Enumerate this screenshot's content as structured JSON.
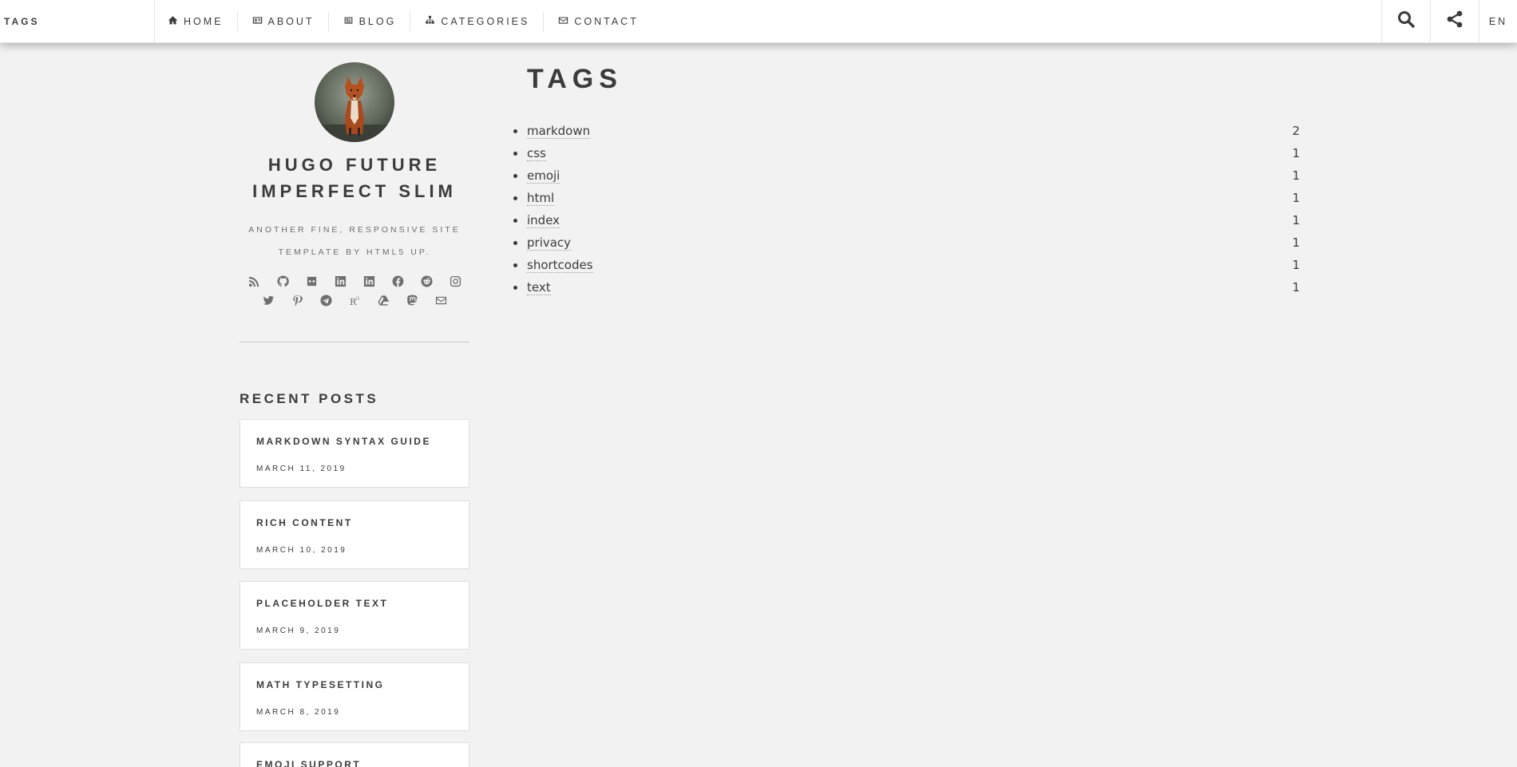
{
  "header": {
    "brand": "TAGS",
    "nav": [
      {
        "label": "HOME",
        "icon": "home-icon"
      },
      {
        "label": "ABOUT",
        "icon": "id-card-icon"
      },
      {
        "label": "BLOG",
        "icon": "newspaper-icon"
      },
      {
        "label": "CATEGORIES",
        "icon": "sitemap-icon"
      },
      {
        "label": "CONTACT",
        "icon": "envelope-icon"
      }
    ],
    "search_icon": "search-icon",
    "share_icon": "share-icon",
    "language": "EN"
  },
  "sidebar": {
    "title": "HUGO FUTURE IMPERFECT SLIM",
    "subtitle": "ANOTHER FINE, RESPONSIVE SITE TEMPLATE BY HTML5 UP.",
    "social_icons": [
      "rss-icon",
      "github-icon",
      "flickr-icon",
      "linkedin-icon",
      "linkedin-square-icon",
      "facebook-icon",
      "reddit-icon",
      "instagram-icon",
      "twitter-icon",
      "pinterest-icon",
      "telegram-icon",
      "researchgate-icon",
      "google-drive-icon",
      "mastodon-icon",
      "envelope-icon"
    ],
    "recent_heading": "RECENT POSTS",
    "recent_posts": [
      {
        "title": "MARKDOWN SYNTAX GUIDE",
        "date": "MARCH 11, 2019"
      },
      {
        "title": "RICH CONTENT",
        "date": "MARCH 10, 2019"
      },
      {
        "title": "PLACEHOLDER TEXT",
        "date": "MARCH 9, 2019"
      },
      {
        "title": "MATH TYPESETTING",
        "date": "MARCH 8, 2019"
      },
      {
        "title": "EMOJI SUPPORT",
        "date": ""
      }
    ]
  },
  "main": {
    "title": "TAGS",
    "tags": [
      {
        "name": "markdown",
        "count": "2"
      },
      {
        "name": "css",
        "count": "1"
      },
      {
        "name": "emoji",
        "count": "1"
      },
      {
        "name": "html",
        "count": "1"
      },
      {
        "name": "index",
        "count": "1"
      },
      {
        "name": "privacy",
        "count": "1"
      },
      {
        "name": "shortcodes",
        "count": "1"
      },
      {
        "name": "text",
        "count": "1"
      }
    ]
  }
}
